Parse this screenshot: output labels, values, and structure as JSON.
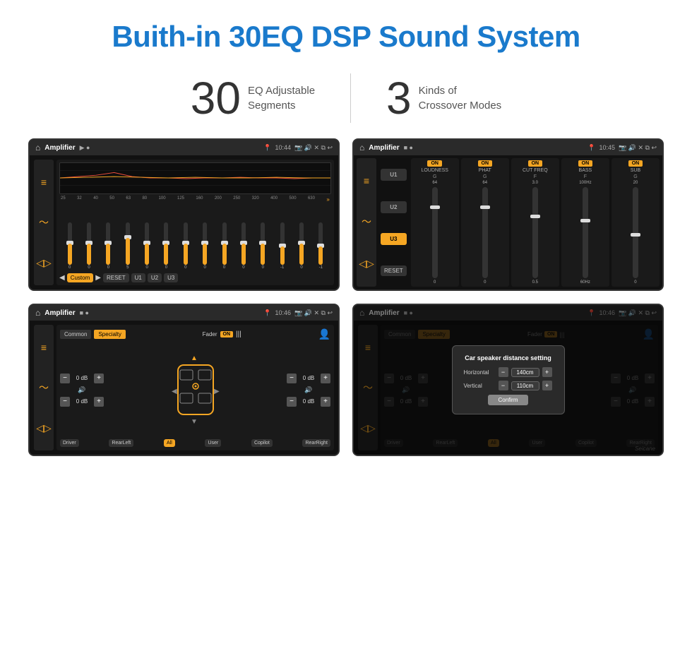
{
  "header": {
    "title": "Buith-in 30EQ DSP Sound System"
  },
  "stats": [
    {
      "number": "30",
      "text_line1": "EQ Adjustable",
      "text_line2": "Segments"
    },
    {
      "number": "3",
      "text_line1": "Kinds of",
      "text_line2": "Crossover Modes"
    }
  ],
  "screens": [
    {
      "id": "screen-1",
      "bar": {
        "home": "⌂",
        "title": "Amplifier",
        "time": "10:44"
      },
      "type": "eq",
      "freqs": [
        "25",
        "32",
        "40",
        "50",
        "63",
        "80",
        "100",
        "125",
        "160",
        "200",
        "250",
        "320",
        "400",
        "500",
        "630"
      ],
      "vals": [
        "0",
        "0",
        "0",
        "5",
        "0",
        "0",
        "0",
        "0",
        "0",
        "0",
        "0",
        "-1",
        "0",
        "-1"
      ],
      "sliders": [
        50,
        50,
        50,
        60,
        50,
        50,
        50,
        50,
        50,
        50,
        50,
        42,
        50,
        42
      ],
      "preset": "Custom",
      "buttons": [
        "RESET",
        "U1",
        "U2",
        "U3"
      ]
    },
    {
      "id": "screen-2",
      "bar": {
        "home": "⌂",
        "title": "Amplifier",
        "time": "10:45"
      },
      "type": "crossover",
      "presets": [
        "U1",
        "U2",
        "U3"
      ],
      "active_preset": "U3",
      "bands": [
        {
          "label": "LOUDNESS",
          "on": true,
          "value": "64"
        },
        {
          "label": "PHAT",
          "on": true,
          "value": "64"
        },
        {
          "label": "CUT FREQ",
          "on": true,
          "value": "3.0"
        },
        {
          "label": "BASS",
          "on": true,
          "value": "100Hz"
        },
        {
          "label": "SUB",
          "on": true,
          "value": "20"
        }
      ],
      "reset_label": "RESET"
    },
    {
      "id": "screen-3",
      "bar": {
        "home": "⌂",
        "title": "Amplifier",
        "time": "10:46"
      },
      "type": "specialty",
      "tabs": [
        "Common",
        "Specialty"
      ],
      "active_tab": "Specialty",
      "fader_label": "Fader",
      "fader_on": "ON",
      "levels": [
        {
          "label": "top-left",
          "val": "0 dB"
        },
        {
          "label": "bottom-left",
          "val": "0 dB"
        },
        {
          "label": "top-right",
          "val": "0 dB"
        },
        {
          "label": "bottom-right",
          "val": "0 dB"
        }
      ],
      "named_btns": [
        "Driver",
        "RearLeft",
        "All",
        "User",
        "Copilot",
        "RearRight"
      ],
      "highlight_btn": "All"
    },
    {
      "id": "screen-4",
      "bar": {
        "home": "⌂",
        "title": "Amplifier",
        "time": "10:46"
      },
      "type": "specialty-dialog",
      "tabs": [
        "Common",
        "Specialty"
      ],
      "active_tab": "Specialty",
      "dialog": {
        "title": "Car speaker distance setting",
        "fields": [
          {
            "label": "Horizontal",
            "value": "140cm"
          },
          {
            "label": "Vertical",
            "value": "110cm"
          }
        ],
        "confirm_label": "Confirm"
      },
      "named_btns": [
        "Driver",
        "RearLeft",
        "All",
        "User",
        "Copilot",
        "RearRight"
      ],
      "levels": [
        {
          "val": "0 dB"
        },
        {
          "val": "0 dB"
        }
      ]
    }
  ],
  "watermark": "Seicane"
}
